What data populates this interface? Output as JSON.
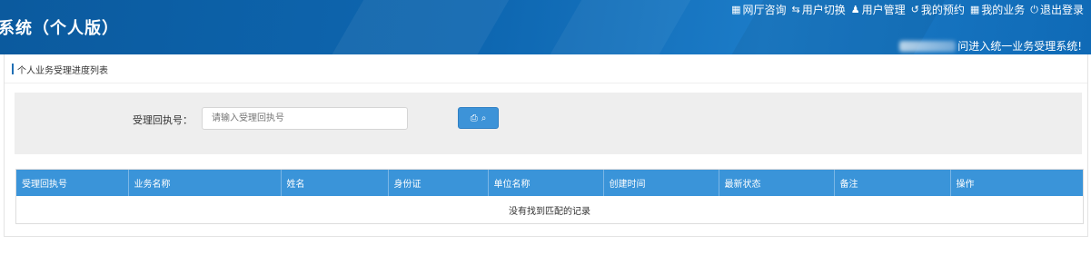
{
  "header": {
    "system_title": "系统（个人版）",
    "nav": [
      {
        "icon": "grid-icon",
        "glyph": "▦",
        "label": "网厅咨询"
      },
      {
        "icon": "switch-icon",
        "glyph": "⇆",
        "label": "用户切换"
      },
      {
        "icon": "user-icon",
        "glyph": "👤",
        "label": "用户管理"
      },
      {
        "icon": "history-icon",
        "glyph": "↺",
        "label": "我的预约"
      },
      {
        "icon": "grid-icon",
        "glyph": "▦",
        "label": "我的业务"
      },
      {
        "icon": "power-icon",
        "glyph": "⏻",
        "label": "退出登录"
      }
    ],
    "welcome_text": "问进入统一业务受理系统!"
  },
  "panel": {
    "title": "个人业务受理进度列表"
  },
  "search": {
    "label": "受理回执号：",
    "placeholder": "请输入受理回执号",
    "button_icons": [
      "print-icon",
      "search-icon"
    ]
  },
  "table": {
    "columns": [
      "受理回执号",
      "业务名称",
      "姓名",
      "身份证",
      "单位名称",
      "创建时间",
      "最新状态",
      "备注",
      "操作"
    ],
    "empty_text": "没有找到匹配的记录"
  },
  "colors": {
    "header_blue": "#0e67b1",
    "table_header": "#3a94d9",
    "button_blue": "#3d93d8"
  }
}
